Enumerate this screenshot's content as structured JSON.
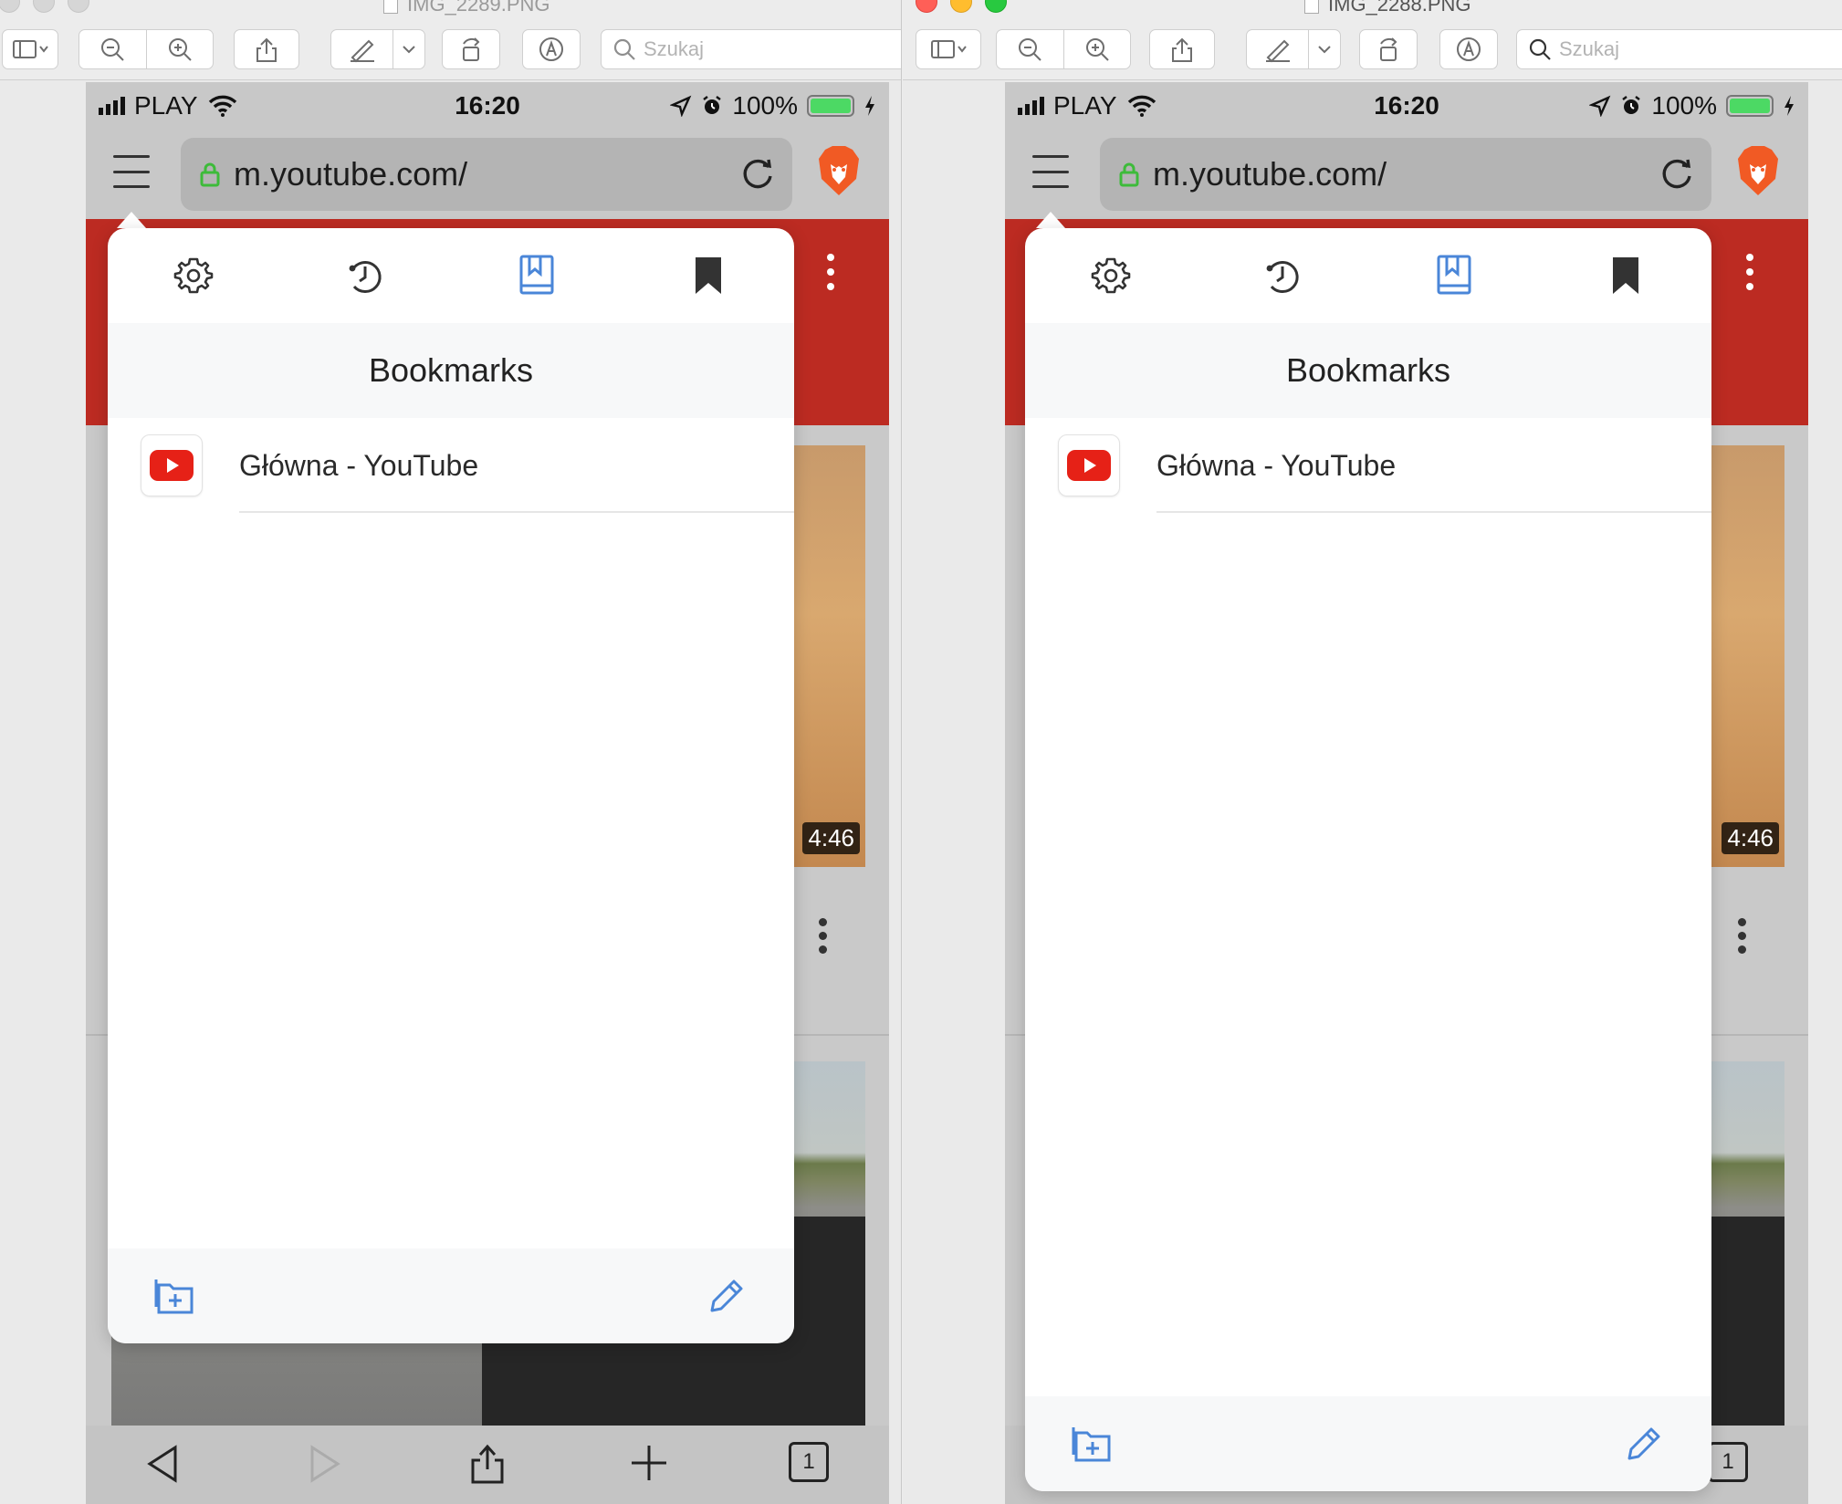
{
  "windows": [
    {
      "title": "IMG_2289.PNG",
      "search_placeholder": "Szukaj",
      "status": {
        "carrier": "PLAY",
        "time": "16:20",
        "battery": "100%"
      },
      "url": "m.youtube.com/",
      "video_duration": "4:46",
      "tab_count": "1",
      "panel": {
        "title": "Bookmarks",
        "bookmarks": [
          {
            "label": "Główna - YouTube"
          }
        ]
      }
    },
    {
      "title": "IMG_2288.PNG",
      "search_placeholder": "Szukaj",
      "status": {
        "carrier": "PLAY",
        "time": "16:20",
        "battery": "100%"
      },
      "url": "m.youtube.com/",
      "video_duration": "4:46",
      "tab_count": "1",
      "panel": {
        "title": "Bookmarks",
        "bookmarks": [
          {
            "label": "Główna - YouTube"
          }
        ]
      }
    }
  ],
  "icons": {
    "tabs": [
      "gear-icon",
      "history-icon",
      "bookmarks-book-icon",
      "bookmark-ribbon-icon"
    ],
    "footer": [
      "new-folder-icon",
      "pencil-icon"
    ]
  },
  "colors": {
    "active_tab": "#4a86d8",
    "youtube_red": "#bc2b22",
    "lock_green": "#3dbb3a",
    "battery_green": "#4cd964"
  }
}
